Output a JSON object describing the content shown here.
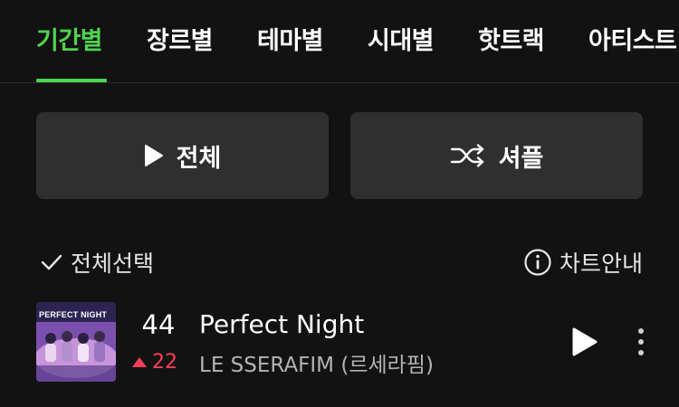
{
  "tabs": [
    {
      "label": "기간별",
      "active": true
    },
    {
      "label": "장르별",
      "active": false
    },
    {
      "label": "테마별",
      "active": false
    },
    {
      "label": "시대별",
      "active": false
    },
    {
      "label": "핫트랙",
      "active": false
    },
    {
      "label": "아티스트",
      "active": false
    }
  ],
  "actions": {
    "play_all_label": "전체",
    "shuffle_label": "셔플"
  },
  "list_controls": {
    "select_all_label": "전체선택",
    "chart_info_label": "차트안내"
  },
  "tracks": [
    {
      "rank": "44",
      "change": "22",
      "change_direction": "up",
      "title": "Perfect Night",
      "artist": "LE SSERAFIM (르세라핌)",
      "album_art_text": "PERFECT NIGHT"
    }
  ],
  "colors": {
    "accent_green": "#4fd44f",
    "rank_up_red": "#ff3c5a",
    "background": "#121212",
    "button_bg": "#2f2f2f"
  },
  "icons": {
    "play_all": "play-icon",
    "shuffle": "shuffle-icon",
    "select_all": "check-icon",
    "chart_info": "info-icon",
    "row_play": "play-icon",
    "row_more": "more-vertical-icon"
  }
}
